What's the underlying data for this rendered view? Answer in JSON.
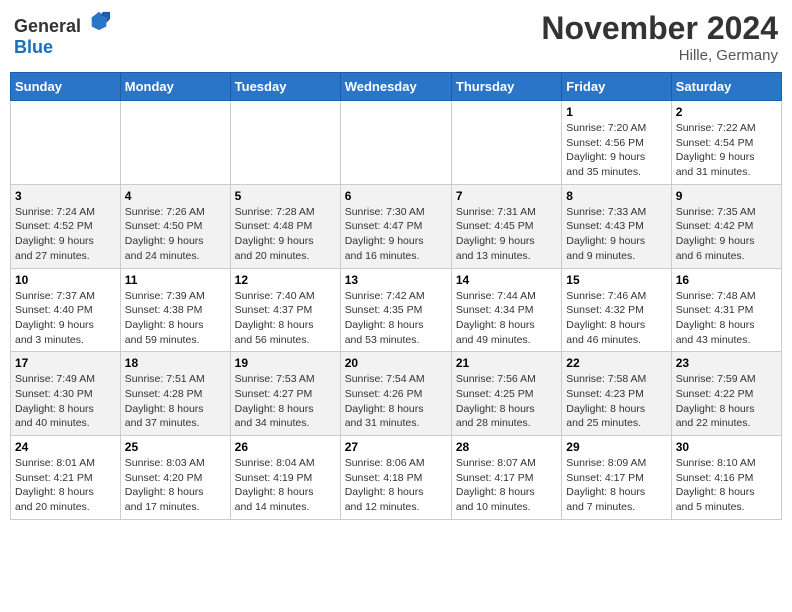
{
  "header": {
    "logo_general": "General",
    "logo_blue": "Blue",
    "month": "November 2024",
    "location": "Hille, Germany"
  },
  "days_of_week": [
    "Sunday",
    "Monday",
    "Tuesday",
    "Wednesday",
    "Thursday",
    "Friday",
    "Saturday"
  ],
  "weeks": [
    [
      {
        "day": "",
        "info": ""
      },
      {
        "day": "",
        "info": ""
      },
      {
        "day": "",
        "info": ""
      },
      {
        "day": "",
        "info": ""
      },
      {
        "day": "",
        "info": ""
      },
      {
        "day": "1",
        "info": "Sunrise: 7:20 AM\nSunset: 4:56 PM\nDaylight: 9 hours\nand 35 minutes."
      },
      {
        "day": "2",
        "info": "Sunrise: 7:22 AM\nSunset: 4:54 PM\nDaylight: 9 hours\nand 31 minutes."
      }
    ],
    [
      {
        "day": "3",
        "info": "Sunrise: 7:24 AM\nSunset: 4:52 PM\nDaylight: 9 hours\nand 27 minutes."
      },
      {
        "day": "4",
        "info": "Sunrise: 7:26 AM\nSunset: 4:50 PM\nDaylight: 9 hours\nand 24 minutes."
      },
      {
        "day": "5",
        "info": "Sunrise: 7:28 AM\nSunset: 4:48 PM\nDaylight: 9 hours\nand 20 minutes."
      },
      {
        "day": "6",
        "info": "Sunrise: 7:30 AM\nSunset: 4:47 PM\nDaylight: 9 hours\nand 16 minutes."
      },
      {
        "day": "7",
        "info": "Sunrise: 7:31 AM\nSunset: 4:45 PM\nDaylight: 9 hours\nand 13 minutes."
      },
      {
        "day": "8",
        "info": "Sunrise: 7:33 AM\nSunset: 4:43 PM\nDaylight: 9 hours\nand 9 minutes."
      },
      {
        "day": "9",
        "info": "Sunrise: 7:35 AM\nSunset: 4:42 PM\nDaylight: 9 hours\nand 6 minutes."
      }
    ],
    [
      {
        "day": "10",
        "info": "Sunrise: 7:37 AM\nSunset: 4:40 PM\nDaylight: 9 hours\nand 3 minutes."
      },
      {
        "day": "11",
        "info": "Sunrise: 7:39 AM\nSunset: 4:38 PM\nDaylight: 8 hours\nand 59 minutes."
      },
      {
        "day": "12",
        "info": "Sunrise: 7:40 AM\nSunset: 4:37 PM\nDaylight: 8 hours\nand 56 minutes."
      },
      {
        "day": "13",
        "info": "Sunrise: 7:42 AM\nSunset: 4:35 PM\nDaylight: 8 hours\nand 53 minutes."
      },
      {
        "day": "14",
        "info": "Sunrise: 7:44 AM\nSunset: 4:34 PM\nDaylight: 8 hours\nand 49 minutes."
      },
      {
        "day": "15",
        "info": "Sunrise: 7:46 AM\nSunset: 4:32 PM\nDaylight: 8 hours\nand 46 minutes."
      },
      {
        "day": "16",
        "info": "Sunrise: 7:48 AM\nSunset: 4:31 PM\nDaylight: 8 hours\nand 43 minutes."
      }
    ],
    [
      {
        "day": "17",
        "info": "Sunrise: 7:49 AM\nSunset: 4:30 PM\nDaylight: 8 hours\nand 40 minutes."
      },
      {
        "day": "18",
        "info": "Sunrise: 7:51 AM\nSunset: 4:28 PM\nDaylight: 8 hours\nand 37 minutes."
      },
      {
        "day": "19",
        "info": "Sunrise: 7:53 AM\nSunset: 4:27 PM\nDaylight: 8 hours\nand 34 minutes."
      },
      {
        "day": "20",
        "info": "Sunrise: 7:54 AM\nSunset: 4:26 PM\nDaylight: 8 hours\nand 31 minutes."
      },
      {
        "day": "21",
        "info": "Sunrise: 7:56 AM\nSunset: 4:25 PM\nDaylight: 8 hours\nand 28 minutes."
      },
      {
        "day": "22",
        "info": "Sunrise: 7:58 AM\nSunset: 4:23 PM\nDaylight: 8 hours\nand 25 minutes."
      },
      {
        "day": "23",
        "info": "Sunrise: 7:59 AM\nSunset: 4:22 PM\nDaylight: 8 hours\nand 22 minutes."
      }
    ],
    [
      {
        "day": "24",
        "info": "Sunrise: 8:01 AM\nSunset: 4:21 PM\nDaylight: 8 hours\nand 20 minutes."
      },
      {
        "day": "25",
        "info": "Sunrise: 8:03 AM\nSunset: 4:20 PM\nDaylight: 8 hours\nand 17 minutes."
      },
      {
        "day": "26",
        "info": "Sunrise: 8:04 AM\nSunset: 4:19 PM\nDaylight: 8 hours\nand 14 minutes."
      },
      {
        "day": "27",
        "info": "Sunrise: 8:06 AM\nSunset: 4:18 PM\nDaylight: 8 hours\nand 12 minutes."
      },
      {
        "day": "28",
        "info": "Sunrise: 8:07 AM\nSunset: 4:17 PM\nDaylight: 8 hours\nand 10 minutes."
      },
      {
        "day": "29",
        "info": "Sunrise: 8:09 AM\nSunset: 4:17 PM\nDaylight: 8 hours\nand 7 minutes."
      },
      {
        "day": "30",
        "info": "Sunrise: 8:10 AM\nSunset: 4:16 PM\nDaylight: 8 hours\nand 5 minutes."
      }
    ]
  ]
}
